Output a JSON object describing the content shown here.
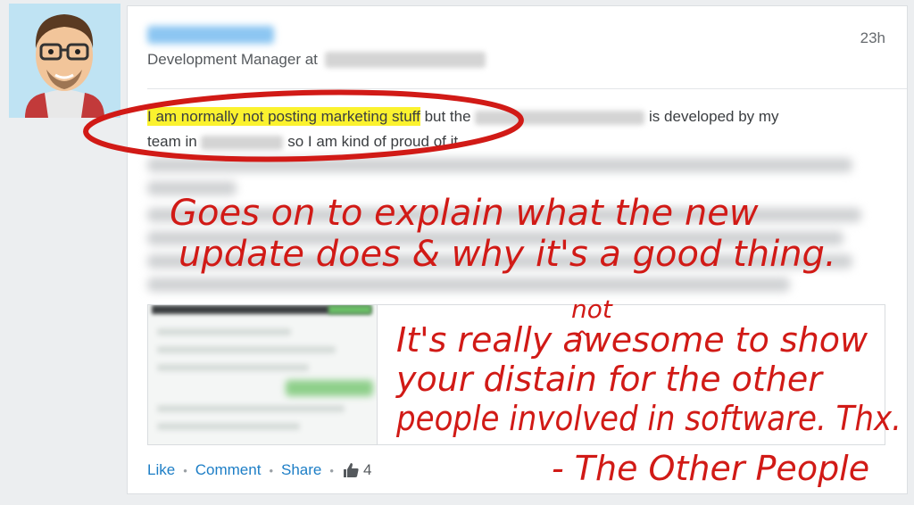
{
  "post": {
    "time": "23h",
    "headline_prefix": "Development Manager at",
    "body_highlight": "I am normally not posting marketing stuff",
    "body_but": "but the",
    "body_developed": "is developed by my",
    "body_team_in": "team in",
    "body_proud": "so I am kind of proud of it"
  },
  "actions": {
    "like": "Like",
    "comment": "Comment",
    "share": "Share",
    "like_count": "4"
  },
  "annotations": {
    "line1": "Goes on to explain what the new",
    "line2": "update does & why it's a good thing.",
    "not": "not",
    "caret": "^",
    "p1": "It's really awesome to show",
    "p2": "your distain for the other",
    "p3": "people involved in software. Thx.",
    "signoff": "- The Other People"
  },
  "colors": {
    "annotation_red": "#d11a16",
    "link_blue": "#1d7ec6",
    "highlight_yellow": "#fbf22e"
  }
}
